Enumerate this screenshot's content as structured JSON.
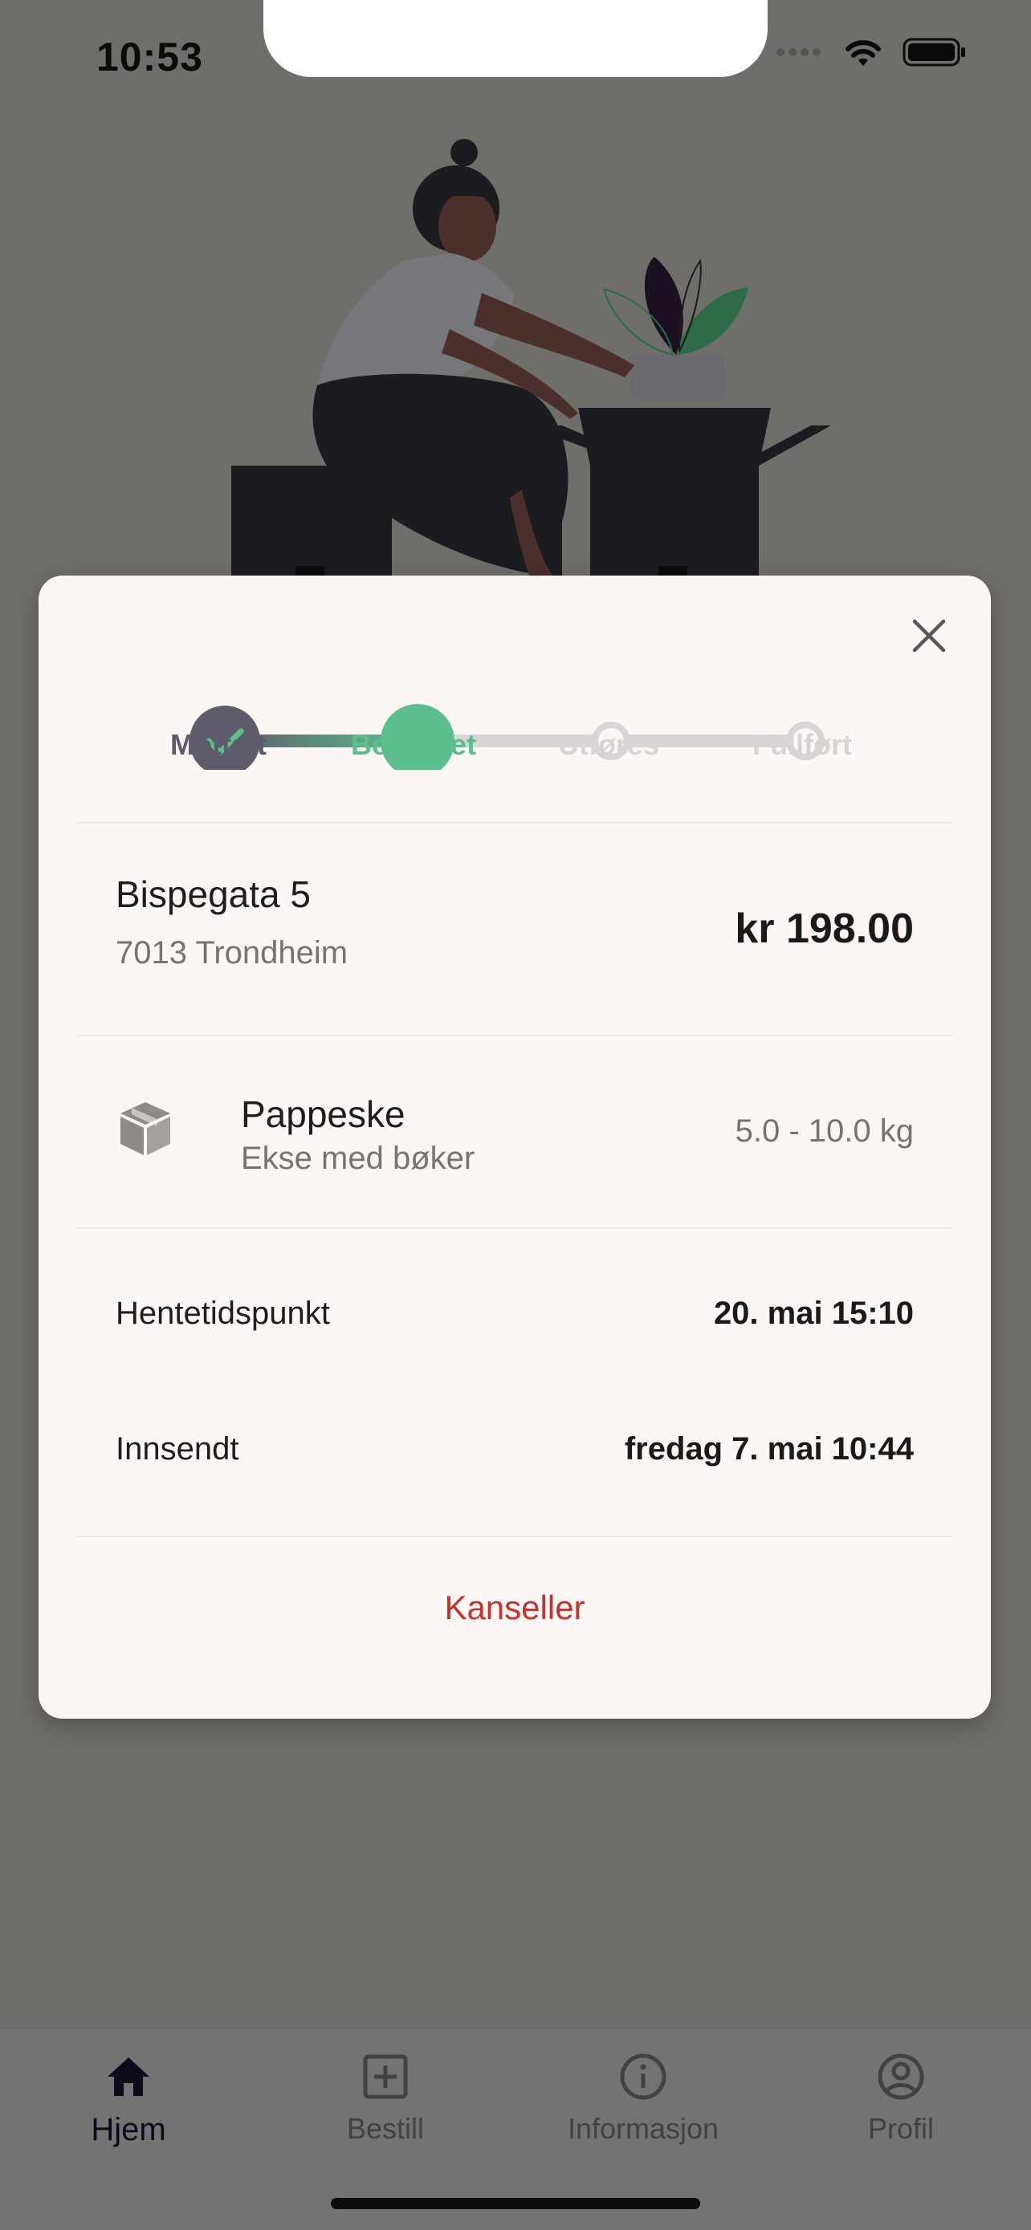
{
  "status_bar": {
    "time": "10:53"
  },
  "order": {
    "steps": [
      {
        "label": "Mottatt",
        "state": "done",
        "color": "#5e5c6b"
      },
      {
        "label": "Bekreftet",
        "state": "current",
        "color": "#5cc08e"
      },
      {
        "label": "Utføres",
        "state": "pending",
        "color": "#d7d4d6"
      },
      {
        "label": "Fullført",
        "state": "pending",
        "color": "#d7d4d6"
      }
    ],
    "address": {
      "street": "Bispegata 5",
      "city": "7013 Trondheim"
    },
    "price": "kr 198.00",
    "package": {
      "icon": "box-icon",
      "name": "Pappeske",
      "description": "Ekse med bøker",
      "weight": "5.0 - 10.0 kg"
    },
    "pickup": {
      "label": "Hentetidspunkt",
      "value": "20. mai 15:10"
    },
    "submitted": {
      "label": "Innsendt",
      "value": "fredag 7. mai 10:44"
    },
    "cancel_label": "Kanseller"
  },
  "tabs": [
    {
      "label": "Hjem",
      "icon": "home-icon",
      "active": true
    },
    {
      "label": "Bestill",
      "icon": "plus-square-icon",
      "active": false
    },
    {
      "label": "Informasjon",
      "icon": "info-icon",
      "active": false
    },
    {
      "label": "Profil",
      "icon": "profile-icon",
      "active": false
    }
  ],
  "colors": {
    "accent_green": "#5cc08e",
    "cancel_red": "#c7322e",
    "overlay": "#6f6e6a",
    "sheet": "#fcf7f4"
  }
}
